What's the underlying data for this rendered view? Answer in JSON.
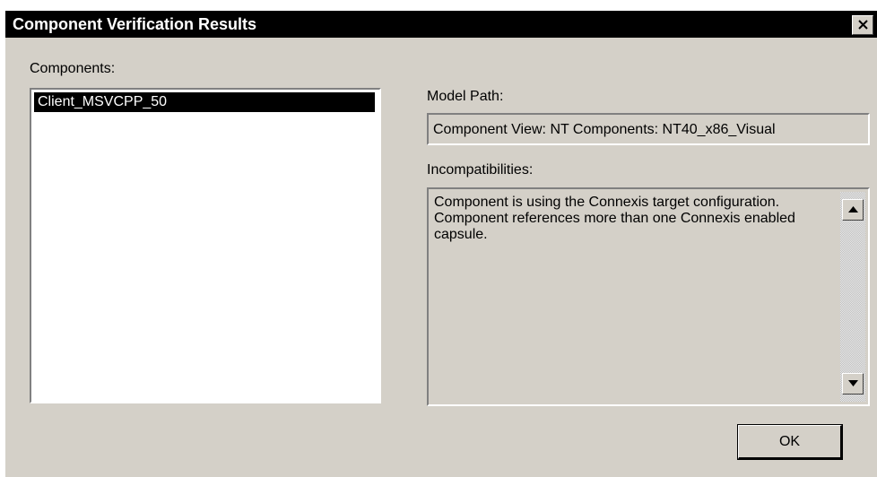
{
  "window": {
    "title": "Component Verification Results",
    "close_icon": "close-icon"
  },
  "components": {
    "label": "Components:",
    "items": [
      {
        "label": "Client_MSVCPP_50",
        "selected": true
      }
    ]
  },
  "model_path": {
    "label": "Model Path:",
    "value": "Component View: NT Components: NT40_x86_Visual"
  },
  "incompatibilities": {
    "label": "Incompatibilities:",
    "lines": [
      "Component is using the Connexis target configuration.",
      "Component references more than one Connexis enabled capsule."
    ]
  },
  "buttons": {
    "ok_label": "OK"
  },
  "colors": {
    "dialog_bg": "#d4d0c8",
    "titlebar_bg": "#000000",
    "selection_bg": "#000000",
    "selection_fg": "#ffffff"
  }
}
